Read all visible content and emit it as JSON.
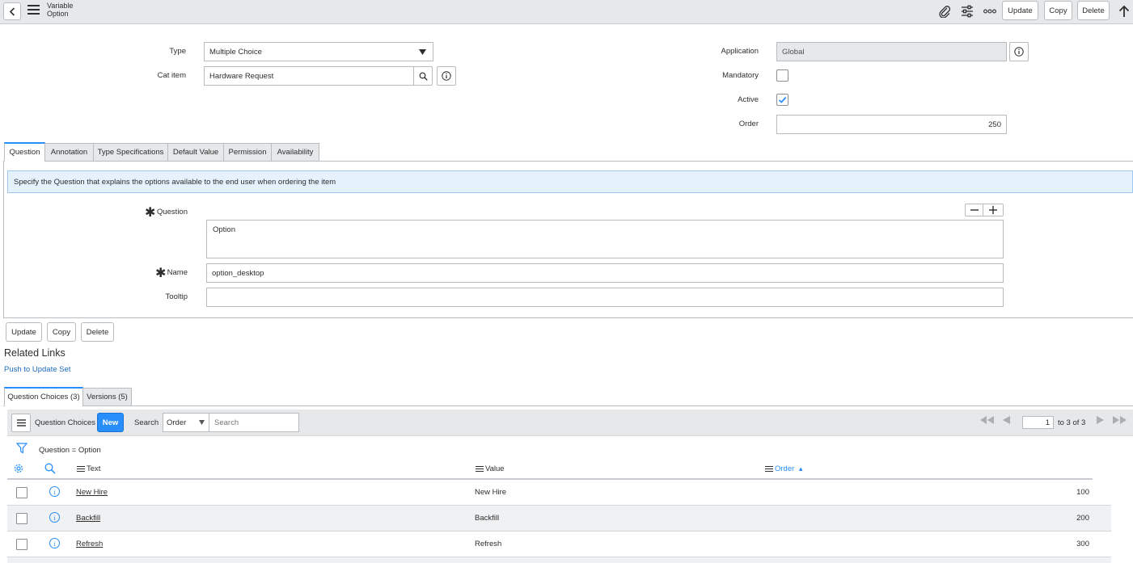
{
  "header": {
    "title_line1": "Variable",
    "title_line2": "Option",
    "update_label": "Update",
    "copy_label": "Copy",
    "delete_label": "Delete"
  },
  "form": {
    "type_label": "Type",
    "type_value": "Multiple Choice",
    "cat_item_label": "Cat item",
    "cat_item_value": "Hardware Request",
    "application_label": "Application",
    "application_value": "Global",
    "mandatory_label": "Mandatory",
    "mandatory_checked": false,
    "active_label": "Active",
    "active_checked": true,
    "order_label": "Order",
    "order_value": "250"
  },
  "tabs": [
    {
      "label": "Question",
      "active": true
    },
    {
      "label": "Annotation",
      "active": false
    },
    {
      "label": "Type Specifications",
      "active": false
    },
    {
      "label": "Default Value",
      "active": false
    },
    {
      "label": "Permission",
      "active": false
    },
    {
      "label": "Availability",
      "active": false
    }
  ],
  "question_tab": {
    "info_text": "Specify the Question that explains the options available to the end user when ordering the item",
    "question_label": "Question",
    "question_value": "Option",
    "name_label": "Name",
    "name_value": "option_desktop",
    "tooltip_label": "Tooltip",
    "tooltip_value": ""
  },
  "bottom_buttons": {
    "update_label": "Update",
    "copy_label": "Copy",
    "delete_label": "Delete"
  },
  "related_links": {
    "title": "Related Links",
    "push_link": "Push to Update Set"
  },
  "related_tabs": [
    {
      "label": "Question Choices (3)",
      "active": true
    },
    {
      "label": "Versions (5)",
      "active": false
    }
  ],
  "list": {
    "title": "Question Choices",
    "new_label": "New",
    "search_label": "Search",
    "search_field": "Order",
    "search_placeholder": "Search",
    "page_input": "1",
    "page_info": "to 3 of 3",
    "filter_text": "Question = Option",
    "columns": [
      "Text",
      "Value",
      "Order"
    ],
    "sort_indicator": "▲",
    "rows": [
      {
        "text": "New Hire",
        "value": "New Hire",
        "order": "100"
      },
      {
        "text": "Backfill",
        "value": "Backfill",
        "order": "200"
      },
      {
        "text": "Refresh",
        "value": "Refresh",
        "order": "300"
      }
    ]
  },
  "colors": {
    "accent": "#278efc",
    "header_bg": "#e6e8ea",
    "info_bg": "#e5f1fd",
    "link": "#1f6bbd"
  },
  "icons": [
    "back-arrow-icon",
    "hamburger-icon",
    "paperclip-icon",
    "sliders-icon",
    "more-icon",
    "up-arrow-icon",
    "search-icon",
    "info-icon",
    "gear-icon",
    "filter-icon",
    "checkmark-icon",
    "minus-icon",
    "plus-icon"
  ]
}
